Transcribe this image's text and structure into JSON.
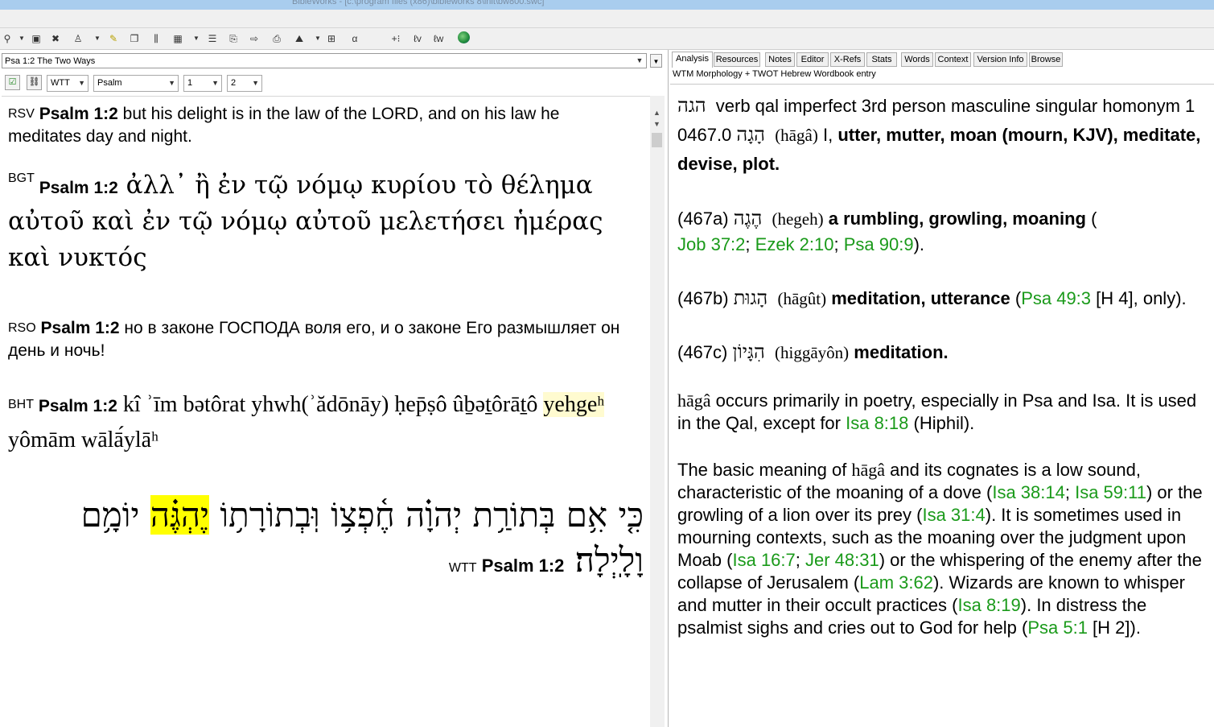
{
  "window": {
    "title": "BibleWorks - [c:\\program files (x86)\\bibleworks 8\\init\\bw800.swc]"
  },
  "left": {
    "reference": "Psa 1:2 The Two Ways",
    "version_select": "WTT",
    "font_select": "Psalm",
    "sel1": "1",
    "sel2": "2",
    "verses": {
      "rsv": {
        "ver": "RSV",
        "ref": "Psalm 1:2",
        "text": " but his delight is in the law of the LORD, and on his law he meditates day and night."
      },
      "bgt": {
        "ver": "BGT",
        "ref": "Psalm 1:2",
        "text": " ἀλλ᾽ ἢ ἐν τῷ νόμῳ κυρίου τὸ θέλημα αὐτοῦ καὶ ἐν τῷ νόμῳ αὐτοῦ μελετήσει ἡμέρας καὶ νυκτός"
      },
      "rso": {
        "ver": "RSO",
        "ref": "Psalm 1:2",
        "text": " но в законе ГОСПОДА воля его, и о законе Его размышляет он день и ночь!"
      },
      "bht": {
        "ver": "BHT",
        "ref": "Psalm 1:2",
        "text_a": " kî ʾīm bətôrat yhwh(ʾădōnāy) ḥep̄ṣô ûḇəṯôrāṯô ",
        "highlight": "yehgeʰ",
        "text_b": " yômām wālā́ylāʰ"
      },
      "wtt": {
        "ver": "WTT",
        "ref": "Psalm 1:2",
        "text_a": "כִּ֤י אִ֥ם בְּתוֹרַ֥ת יְהוָ֗ה חֶ֫פְצ֥וֹ וּֽבְתוֹרָת֥וֹ ",
        "highlight": "יֶהְגֶּ֗ה",
        "text_b": " יוֹמָ֥ם וָלָֽיְלָה׃"
      }
    }
  },
  "right": {
    "tabs": [
      "Analysis",
      "Resources",
      "Notes",
      "Editor",
      "X-Refs",
      "Stats",
      "Words",
      "Context",
      "Version Info",
      "Browse"
    ],
    "subtitle": "WTM Morphology + TWOT Hebrew Wordbook entry",
    "entry": {
      "lemma": "הגה",
      "parse": "verb qal imperfect 3rd person masculine singular homonym 1",
      "num": "0467.0",
      "heb": "הָגָה",
      "translit": "(hāgâ)",
      "sense_num": "I,",
      "gloss": "utter, mutter, moan (mourn, KJV), meditate, devise, plot.",
      "a_num": "(467a)",
      "a_heb": "הֶגֶה",
      "a_tr": "(hegeh)",
      "a_gloss": "a rumbling, growling, moaning",
      "a_refs": [
        "Job 37:2",
        "Ezek 2:10",
        "Psa 90:9"
      ],
      "b_num": "(467b)",
      "b_heb": "הָגוּת",
      "b_tr": "(hāgût)",
      "b_gloss": "meditation, utterance",
      "b_ref": "Psa 49:3",
      "b_tail": "[H 4], only).",
      "c_num": "(467c)",
      "c_heb": "הִגָּיוֹן",
      "c_tr": "(higgāyôn)",
      "c_gloss": "meditation.",
      "p1_tr": "hāgâ",
      "p1_a": " occurs primarily in poetry, especially in Psa and Isa. It is used in the Qal, except for ",
      "p1_ref": "Isa 8:18",
      "p1_b": " (Hiphil).",
      "p2_a": "The basic meaning of ",
      "p2_tr": "hāgâ",
      "p2_b": " and its cognates is a low sound, characteristic of the moaning of a dove (",
      "r1": "Isa 38:14",
      "r2": "Isa 59:11",
      "p2_c": ") or the growling of a lion over its prey (",
      "r3": "Isa 31:4",
      "p2_d": "). It is sometimes used in mourning contexts, such as the moaning over the judgment upon Moab (",
      "r4": "Isa 16:7",
      "r5": "Jer 48:31",
      "p2_e": ") or the whispering of the enemy after the collapse of Jerusalem (",
      "r6": "Lam 3:62",
      "p2_f": "). Wizards are known to whisper and mutter in their occult practices (",
      "r7": "Isa 8:19",
      "p2_g": "). In distress the psalmist sighs and cries out to God for help (",
      "r8": "Psa 5:1",
      "p2_h": " [H 2])."
    }
  },
  "colors": {
    "link": "#1a9a1a",
    "highlight": "#ffff00",
    "highlight_light": "#fffbd0",
    "titlebar": "#a9cdee"
  }
}
